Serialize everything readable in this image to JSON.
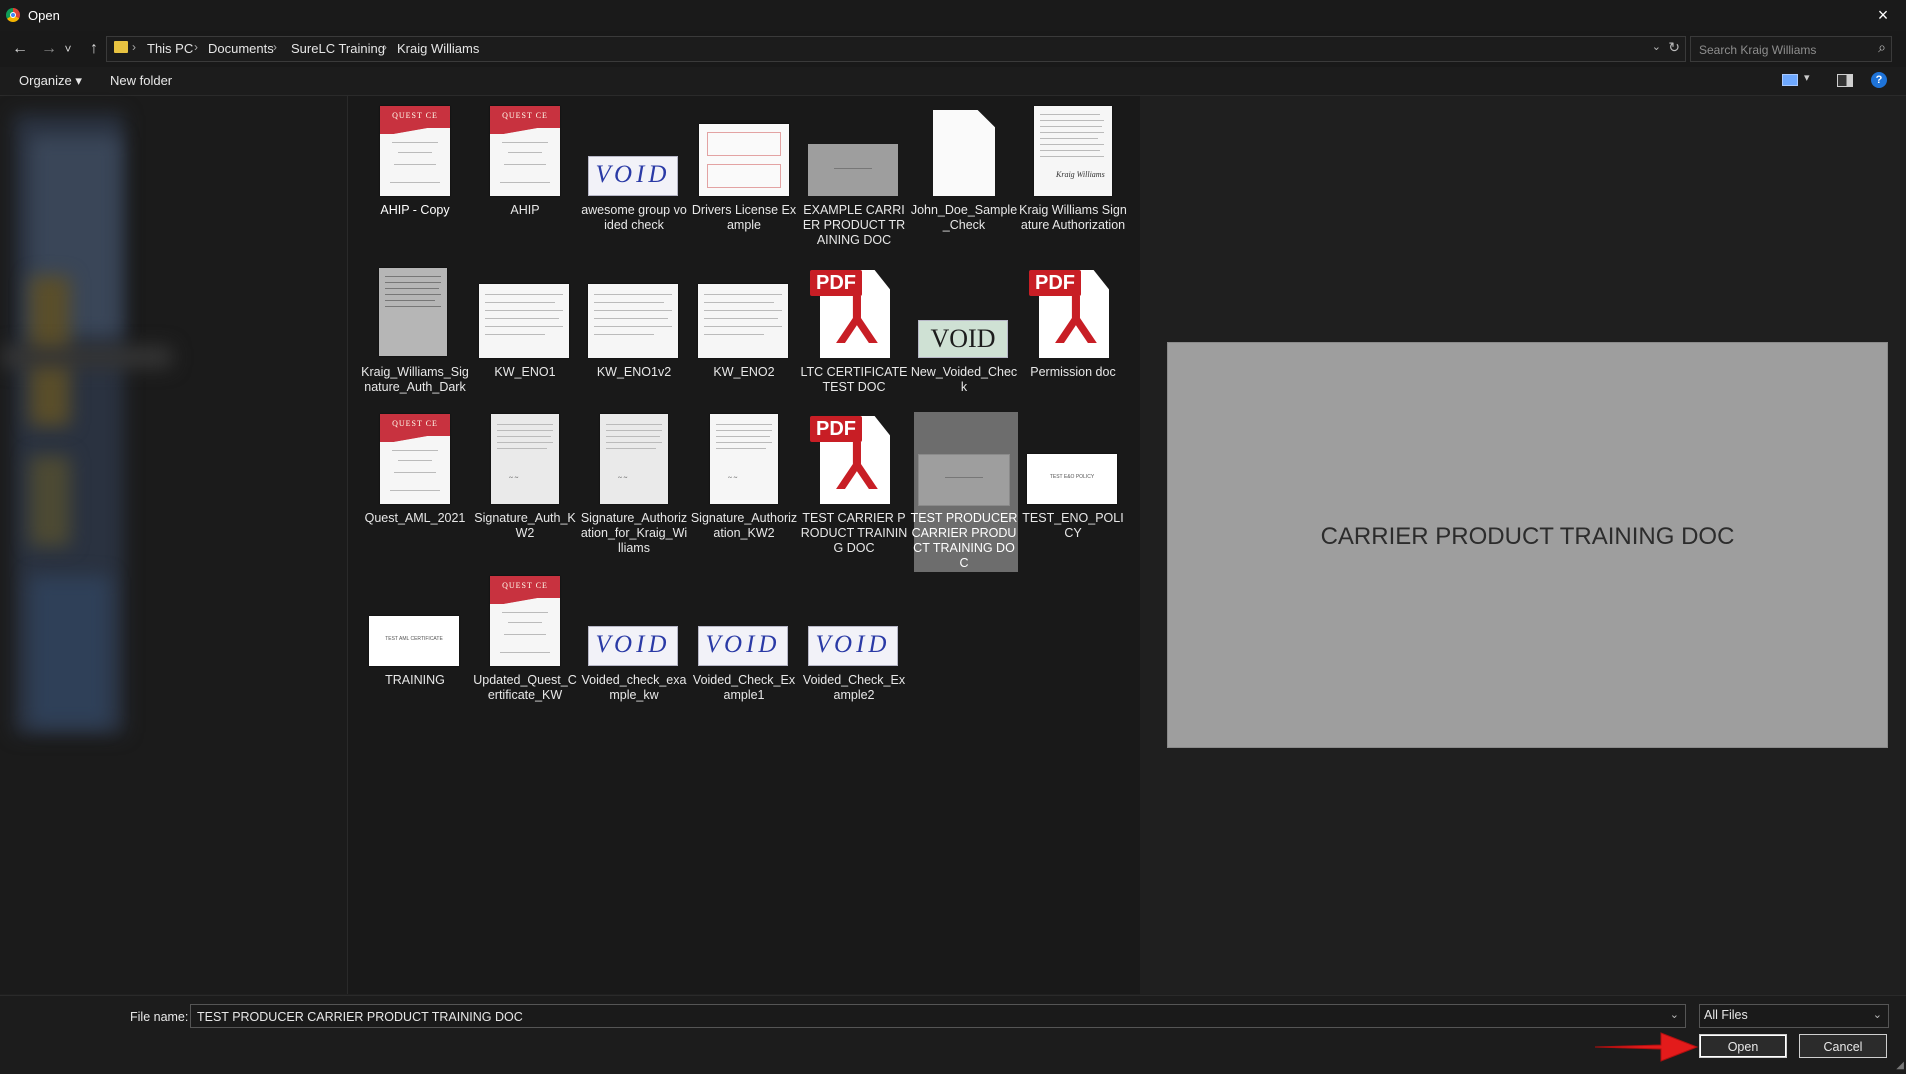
{
  "window": {
    "title": "Open",
    "close_icon": "×"
  },
  "nav": {
    "back_icon": "←",
    "forward_icon": "→",
    "recent_icon": "˅",
    "up_icon": "↑"
  },
  "breadcrumbs": [
    "This PC",
    "Documents",
    "SureLC Training",
    "Kraig Williams"
  ],
  "search": {
    "placeholder": "Search Kraig Williams"
  },
  "toolbar": {
    "organize": "Organize ▾",
    "new_folder": "New folder",
    "help": "?"
  },
  "files": [
    {
      "label": "AHIP - Copy",
      "kind": "cert"
    },
    {
      "label": "AHIP",
      "kind": "cert"
    },
    {
      "label": "awesome group voided check",
      "kind": "void"
    },
    {
      "label": "Drivers License Example",
      "kind": "license"
    },
    {
      "label": "EXAMPLE CARRIER PRODUCT TRAINING DOC",
      "kind": "graybox"
    },
    {
      "label": "John_Doe_Sample_Check",
      "kind": "blank"
    },
    {
      "label": "Kraig Williams Signature Authorization",
      "kind": "letter"
    },
    {
      "label": "Kraig_Williams_Signature_Auth_Dark",
      "kind": "darkletter"
    },
    {
      "label": "KW_ENO1",
      "kind": "form"
    },
    {
      "label": "KW_ENO1v2",
      "kind": "form"
    },
    {
      "label": "KW_ENO2",
      "kind": "form"
    },
    {
      "label": "LTC CERTIFICATE TEST DOC",
      "kind": "pdf"
    },
    {
      "label": "New_Voided_Check",
      "kind": "newvoid"
    },
    {
      "label": "Permission doc",
      "kind": "pdf"
    },
    {
      "label": "Quest_AML_2021",
      "kind": "cert"
    },
    {
      "label": "Signature_Auth_KW2",
      "kind": "letter"
    },
    {
      "label": "Signature_Authorization_for_Kraig_Williams",
      "kind": "letter"
    },
    {
      "label": "Signature_Authorization_KW2",
      "kind": "letter"
    },
    {
      "label": "TEST CARRIER PRODUCT TRAINING DOC",
      "kind": "pdf"
    },
    {
      "label": "TEST PRODUCER CARRIER PRODUCT TRAINING DOC",
      "kind": "graybox",
      "selected": true
    },
    {
      "label": "TEST_ENO_POLICY",
      "kind": "whitebox"
    },
    {
      "label": "TRAINING",
      "kind": "whitebox2"
    },
    {
      "label": "Updated_Quest_Certificate_KW",
      "kind": "cert"
    },
    {
      "label": "Voided_check_example_kw",
      "kind": "void"
    },
    {
      "label": "Voided_Check_Example1",
      "kind": "void"
    },
    {
      "label": "Voided_Check_Example2",
      "kind": "void"
    }
  ],
  "thumb_text": {
    "cert": "QUEST CE",
    "void": "VOID",
    "pdf": "PDF",
    "sig": "Kraig Williams",
    "eno": "TEST E&O POLICY",
    "aml": "TEST AML CERTIFICATE"
  },
  "preview": {
    "text": "CARRIER PRODUCT TRAINING DOC"
  },
  "bottom": {
    "filename_label": "File name:",
    "filename_value": "TEST PRODUCER CARRIER PRODUCT TRAINING DOC",
    "filetype_value": "All Files",
    "open_label": "Open",
    "cancel_label": "Cancel"
  },
  "colors": {
    "accent_arrow": "#e31b1b",
    "selection": "#6d6d6d",
    "pdf_red": "#c81e25"
  }
}
